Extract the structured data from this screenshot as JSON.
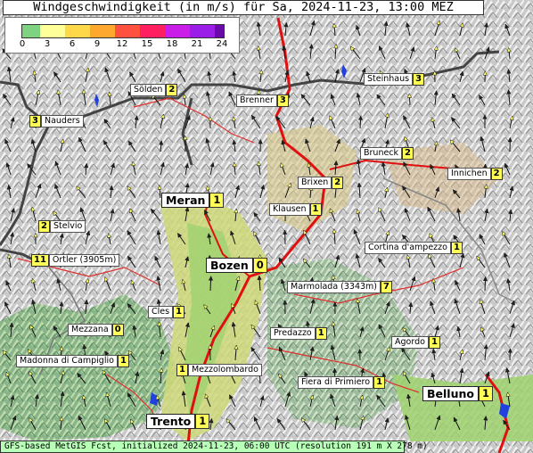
{
  "title": "Windgeschwindigkeit (in m/s) für Sa, 2024-11-23, 13:00 MEZ",
  "legend": {
    "ticks": [
      "0",
      "3",
      "6",
      "9",
      "12",
      "15",
      "18",
      "21",
      "24"
    ],
    "colors": [
      "#7fd27f",
      "#ffff99",
      "#ffd84a",
      "#ffa830",
      "#ff5040",
      "#ff1e60",
      "#c81ee8",
      "#9a1ee8",
      "#6a0aa8"
    ]
  },
  "stations": [
    {
      "name": "Steinhaus",
      "value": "3",
      "city": false
    },
    {
      "name": "Sölden",
      "value": "2",
      "city": false
    },
    {
      "name": "Brenner",
      "value": "3",
      "city": false
    },
    {
      "name": "Nauders",
      "value": "3",
      "city": false,
      "value_first": true
    },
    {
      "name": "Bruneck",
      "value": "2",
      "city": false
    },
    {
      "name": "Innichen",
      "value": "2",
      "city": false
    },
    {
      "name": "Brixen",
      "value": "2",
      "city": false
    },
    {
      "name": "Meran",
      "value": "1",
      "city": true
    },
    {
      "name": "Klausen",
      "value": "1",
      "city": false
    },
    {
      "name": "Stelvio",
      "value": "2",
      "city": false,
      "value_first": true
    },
    {
      "name": "Cortina d'ampezzo",
      "value": "1",
      "city": false
    },
    {
      "name": "Ortler (3905m)",
      "value": "11",
      "city": false,
      "value_first": true
    },
    {
      "name": "Bozen",
      "value": "0",
      "city": true
    },
    {
      "name": "Marmolada (3343m)",
      "value": "7",
      "city": false
    },
    {
      "name": "Cles",
      "value": "1",
      "city": false
    },
    {
      "name": "Mezzana",
      "value": "0",
      "city": false
    },
    {
      "name": "Predazzo",
      "value": "1",
      "city": false
    },
    {
      "name": "Agordo",
      "value": "1",
      "city": false
    },
    {
      "name": "Madonna di Campiglio",
      "value": "1",
      "city": false
    },
    {
      "name": "Mezzolombardo",
      "value": "1",
      "city": false,
      "value_first": true
    },
    {
      "name": "Fiera di Primiero",
      "value": "1",
      "city": false
    },
    {
      "name": "Belluno",
      "value": "1",
      "city": true
    },
    {
      "name": "Trento",
      "value": "1",
      "city": true
    }
  ],
  "footer": "GFS-based MetGIS Fcst, initialized 2024-11-23, 06:00 UTC  (resolution 191 m X 278 m)"
}
